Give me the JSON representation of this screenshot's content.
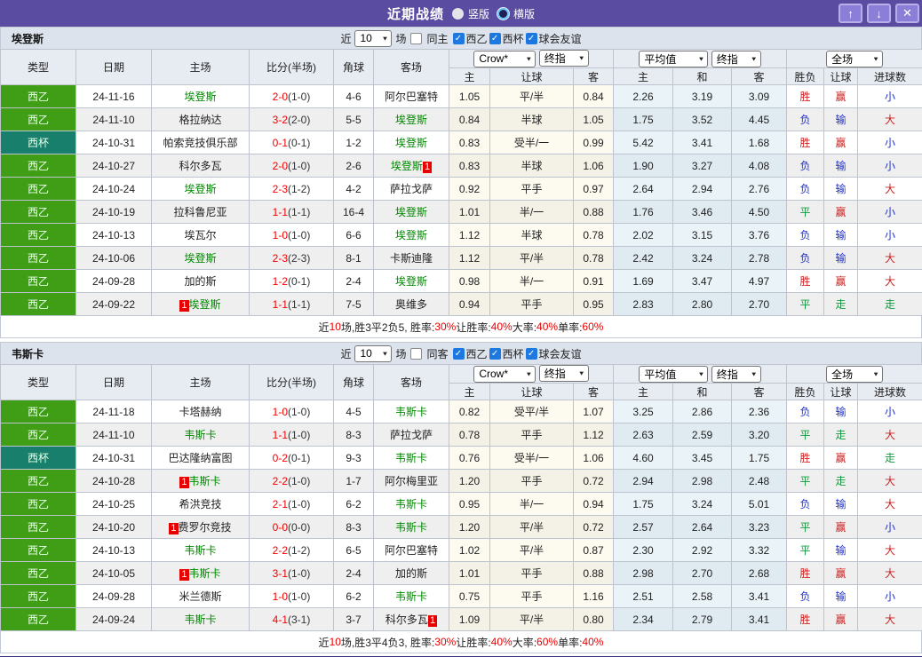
{
  "titlebar": {
    "title": "近期战绩",
    "vertical_label": "竖版",
    "horizontal_label": "横版",
    "vertical_checked": false,
    "horizontal_checked": true,
    "up_glyph": "↑",
    "down_glyph": "↓",
    "close_glyph": "✕"
  },
  "colors": {
    "titlebar_purple": "#5a4ca0",
    "bottom_bar_purple": "#3a3383",
    "league_green": "#3f9d16",
    "cup_teal": "#177f6b",
    "focus_team_green": "#008800",
    "score_red": "#f20000",
    "win_red": "#cc2222",
    "lose_blue": "#2233cc",
    "draw_green": "#159940",
    "badge_red": "#e80000"
  },
  "table_header": {
    "main_cols": [
      "类型",
      "日期",
      "主场",
      "比分(半场)",
      "角球",
      "客场"
    ],
    "sub_cols": [
      "主",
      "让球",
      "客",
      "主",
      "和",
      "客",
      "胜负",
      "让球",
      "进球数"
    ],
    "group1_select1": "Crow*",
    "group1_select2": "终指",
    "group2_select1": "平均值",
    "group2_select2": "终指",
    "group3_select": "全场"
  },
  "sections": [
    {
      "team": "埃登斯",
      "filter": {
        "near_label": "近",
        "count": "10",
        "games_label": "场",
        "same_label": "同主",
        "same_checked": false,
        "leagues": [
          {
            "label": "西乙",
            "checked": true
          },
          {
            "label": "西杯",
            "checked": true
          },
          {
            "label": "球会友谊",
            "checked": true
          }
        ]
      },
      "rows": [
        {
          "lg": "西乙",
          "lgc": "g",
          "date": "24-11-16",
          "home": {
            "pre": "",
            "name": "埃登斯",
            "post": "",
            "f": true
          },
          "score": "2-0",
          "half": "(1-0)",
          "cor": "4-6",
          "away": {
            "pre": "",
            "name": "阿尔巴塞特",
            "post": "",
            "f": false
          },
          "odds": [
            "1.05",
            "平/半",
            "0.84"
          ],
          "avg": [
            "2.26",
            "3.19",
            "3.09"
          ],
          "res": [
            [
              "胜",
              "r"
            ],
            [
              "赢",
              "r"
            ],
            [
              "小",
              "b"
            ]
          ]
        },
        {
          "lg": "西乙",
          "lgc": "g",
          "date": "24-11-10",
          "home": {
            "pre": "",
            "name": "格拉纳达",
            "post": "",
            "f": false
          },
          "score": "3-2",
          "half": "(2-0)",
          "cor": "5-5",
          "away": {
            "pre": "",
            "name": "埃登斯",
            "post": "",
            "f": true
          },
          "odds": [
            "0.84",
            "半球",
            "1.05"
          ],
          "avg": [
            "1.75",
            "3.52",
            "4.45"
          ],
          "res": [
            [
              "负",
              "b"
            ],
            [
              "输",
              "b"
            ],
            [
              "大",
              "r"
            ]
          ]
        },
        {
          "lg": "西杯",
          "lgc": "t",
          "date": "24-10-31",
          "home": {
            "pre": "",
            "name": "帕索竞技俱乐部",
            "post": "",
            "f": false
          },
          "score": "0-1",
          "half": "(0-1)",
          "cor": "1-2",
          "away": {
            "pre": "",
            "name": "埃登斯",
            "post": "",
            "f": true
          },
          "odds": [
            "0.83",
            "受半/一",
            "0.99"
          ],
          "avg": [
            "5.42",
            "3.41",
            "1.68"
          ],
          "res": [
            [
              "胜",
              "r"
            ],
            [
              "赢",
              "r"
            ],
            [
              "小",
              "b"
            ]
          ]
        },
        {
          "lg": "西乙",
          "lgc": "g",
          "date": "24-10-27",
          "home": {
            "pre": "",
            "name": "科尔多瓦",
            "post": "",
            "f": false
          },
          "score": "2-0",
          "half": "(1-0)",
          "cor": "2-6",
          "away": {
            "pre": "",
            "name": "埃登斯",
            "post": "1",
            "f": true
          },
          "odds": [
            "0.83",
            "半球",
            "1.06"
          ],
          "avg": [
            "1.90",
            "3.27",
            "4.08"
          ],
          "res": [
            [
              "负",
              "b"
            ],
            [
              "输",
              "b"
            ],
            [
              "小",
              "b"
            ]
          ]
        },
        {
          "lg": "西乙",
          "lgc": "g",
          "date": "24-10-24",
          "home": {
            "pre": "",
            "name": "埃登斯",
            "post": "",
            "f": true
          },
          "score": "2-3",
          "half": "(1-2)",
          "cor": "4-2",
          "away": {
            "pre": "",
            "name": "萨拉戈萨",
            "post": "",
            "f": false
          },
          "odds": [
            "0.92",
            "平手",
            "0.97"
          ],
          "avg": [
            "2.64",
            "2.94",
            "2.76"
          ],
          "res": [
            [
              "负",
              "b"
            ],
            [
              "输",
              "b"
            ],
            [
              "大",
              "r"
            ]
          ]
        },
        {
          "lg": "西乙",
          "lgc": "g",
          "date": "24-10-19",
          "home": {
            "pre": "",
            "name": "拉科鲁尼亚",
            "post": "",
            "f": false
          },
          "score": "1-1",
          "half": "(1-1)",
          "cor": "16-4",
          "away": {
            "pre": "",
            "name": "埃登斯",
            "post": "",
            "f": true
          },
          "odds": [
            "1.01",
            "半/一",
            "0.88"
          ],
          "avg": [
            "1.76",
            "3.46",
            "4.50"
          ],
          "res": [
            [
              "平",
              "g"
            ],
            [
              "赢",
              "r"
            ],
            [
              "小",
              "b"
            ]
          ]
        },
        {
          "lg": "西乙",
          "lgc": "g",
          "date": "24-10-13",
          "home": {
            "pre": "",
            "name": "埃瓦尔",
            "post": "",
            "f": false
          },
          "score": "1-0",
          "half": "(1-0)",
          "cor": "6-6",
          "away": {
            "pre": "",
            "name": "埃登斯",
            "post": "",
            "f": true
          },
          "odds": [
            "1.12",
            "半球",
            "0.78"
          ],
          "avg": [
            "2.02",
            "3.15",
            "3.76"
          ],
          "res": [
            [
              "负",
              "b"
            ],
            [
              "输",
              "b"
            ],
            [
              "小",
              "b"
            ]
          ]
        },
        {
          "lg": "西乙",
          "lgc": "g",
          "date": "24-10-06",
          "home": {
            "pre": "",
            "name": "埃登斯",
            "post": "",
            "f": true
          },
          "score": "2-3",
          "half": "(2-3)",
          "cor": "8-1",
          "away": {
            "pre": "",
            "name": "卡斯迪隆",
            "post": "",
            "f": false
          },
          "odds": [
            "1.12",
            "平/半",
            "0.78"
          ],
          "avg": [
            "2.42",
            "3.24",
            "2.78"
          ],
          "res": [
            [
              "负",
              "b"
            ],
            [
              "输",
              "b"
            ],
            [
              "大",
              "r"
            ]
          ]
        },
        {
          "lg": "西乙",
          "lgc": "g",
          "date": "24-09-28",
          "home": {
            "pre": "",
            "name": "加的斯",
            "post": "",
            "f": false
          },
          "score": "1-2",
          "half": "(0-1)",
          "cor": "2-4",
          "away": {
            "pre": "",
            "name": "埃登斯",
            "post": "",
            "f": true
          },
          "odds": [
            "0.98",
            "半/一",
            "0.91"
          ],
          "avg": [
            "1.69",
            "3.47",
            "4.97"
          ],
          "res": [
            [
              "胜",
              "r"
            ],
            [
              "赢",
              "r"
            ],
            [
              "大",
              "r"
            ]
          ]
        },
        {
          "lg": "西乙",
          "lgc": "g",
          "date": "24-09-22",
          "home": {
            "pre": "1",
            "name": "埃登斯",
            "post": "",
            "f": true
          },
          "score": "1-1",
          "half": "(1-1)",
          "cor": "7-5",
          "away": {
            "pre": "",
            "name": "奥维多",
            "post": "",
            "f": false
          },
          "odds": [
            "0.94",
            "平手",
            "0.95"
          ],
          "avg": [
            "2.83",
            "2.80",
            "2.70"
          ],
          "res": [
            [
              "平",
              "g"
            ],
            [
              "走",
              "g"
            ],
            [
              "走",
              "g"
            ]
          ]
        }
      ],
      "summary": [
        [
          "近",
          0
        ],
        [
          "10",
          1
        ],
        [
          "场,胜3平2负5, 胜率:",
          0
        ],
        [
          "30%",
          1
        ],
        [
          " 让胜率:",
          0
        ],
        [
          "40%",
          1
        ],
        [
          " 大率:",
          0
        ],
        [
          "40%",
          1
        ],
        [
          " 单率:",
          0
        ],
        [
          "60%",
          1
        ]
      ]
    },
    {
      "team": "韦斯卡",
      "filter": {
        "near_label": "近",
        "count": "10",
        "games_label": "场",
        "same_label": "同客",
        "same_checked": false,
        "leagues": [
          {
            "label": "西乙",
            "checked": true
          },
          {
            "label": "西杯",
            "checked": true
          },
          {
            "label": "球会友谊",
            "checked": true
          }
        ]
      },
      "rows": [
        {
          "lg": "西乙",
          "lgc": "g",
          "date": "24-11-18",
          "home": {
            "pre": "",
            "name": "卡塔赫纳",
            "post": "",
            "f": false
          },
          "score": "1-0",
          "half": "(1-0)",
          "cor": "4-5",
          "away": {
            "pre": "",
            "name": "韦斯卡",
            "post": "",
            "f": true
          },
          "odds": [
            "0.82",
            "受平/半",
            "1.07"
          ],
          "avg": [
            "3.25",
            "2.86",
            "2.36"
          ],
          "res": [
            [
              "负",
              "b"
            ],
            [
              "输",
              "b"
            ],
            [
              "小",
              "b"
            ]
          ]
        },
        {
          "lg": "西乙",
          "lgc": "g",
          "date": "24-11-10",
          "home": {
            "pre": "",
            "name": "韦斯卡",
            "post": "",
            "f": true
          },
          "score": "1-1",
          "half": "(1-0)",
          "cor": "8-3",
          "away": {
            "pre": "",
            "name": "萨拉戈萨",
            "post": "",
            "f": false
          },
          "odds": [
            "0.78",
            "平手",
            "1.12"
          ],
          "avg": [
            "2.63",
            "2.59",
            "3.20"
          ],
          "res": [
            [
              "平",
              "g"
            ],
            [
              "走",
              "g"
            ],
            [
              "大",
              "r"
            ]
          ]
        },
        {
          "lg": "西杯",
          "lgc": "t",
          "date": "24-10-31",
          "home": {
            "pre": "",
            "name": "巴达隆纳富图",
            "post": "",
            "f": false
          },
          "score": "0-2",
          "half": "(0-1)",
          "cor": "9-3",
          "away": {
            "pre": "",
            "name": "韦斯卡",
            "post": "",
            "f": true
          },
          "odds": [
            "0.76",
            "受半/一",
            "1.06"
          ],
          "avg": [
            "4.60",
            "3.45",
            "1.75"
          ],
          "res": [
            [
              "胜",
              "r"
            ],
            [
              "赢",
              "r"
            ],
            [
              "走",
              "g"
            ]
          ]
        },
        {
          "lg": "西乙",
          "lgc": "g",
          "date": "24-10-28",
          "home": {
            "pre": "1",
            "name": "韦斯卡",
            "post": "",
            "f": true
          },
          "score": "2-2",
          "half": "(1-0)",
          "cor": "1-7",
          "away": {
            "pre": "",
            "name": "阿尔梅里亚",
            "post": "",
            "f": false
          },
          "odds": [
            "1.20",
            "平手",
            "0.72"
          ],
          "avg": [
            "2.94",
            "2.98",
            "2.48"
          ],
          "res": [
            [
              "平",
              "g"
            ],
            [
              "走",
              "g"
            ],
            [
              "大",
              "r"
            ]
          ]
        },
        {
          "lg": "西乙",
          "lgc": "g",
          "date": "24-10-25",
          "home": {
            "pre": "",
            "name": "希洪竞技",
            "post": "",
            "f": false
          },
          "score": "2-1",
          "half": "(1-0)",
          "cor": "6-2",
          "away": {
            "pre": "",
            "name": "韦斯卡",
            "post": "",
            "f": true
          },
          "odds": [
            "0.95",
            "半/一",
            "0.94"
          ],
          "avg": [
            "1.75",
            "3.24",
            "5.01"
          ],
          "res": [
            [
              "负",
              "b"
            ],
            [
              "输",
              "b"
            ],
            [
              "大",
              "r"
            ]
          ]
        },
        {
          "lg": "西乙",
          "lgc": "g",
          "date": "24-10-20",
          "home": {
            "pre": "1",
            "name": "费罗尔竞技",
            "post": "",
            "f": false
          },
          "score": "0-0",
          "half": "(0-0)",
          "cor": "8-3",
          "away": {
            "pre": "",
            "name": "韦斯卡",
            "post": "",
            "f": true
          },
          "odds": [
            "1.20",
            "平/半",
            "0.72"
          ],
          "avg": [
            "2.57",
            "2.64",
            "3.23"
          ],
          "res": [
            [
              "平",
              "g"
            ],
            [
              "赢",
              "r"
            ],
            [
              "小",
              "b"
            ]
          ]
        },
        {
          "lg": "西乙",
          "lgc": "g",
          "date": "24-10-13",
          "home": {
            "pre": "",
            "name": "韦斯卡",
            "post": "",
            "f": true
          },
          "score": "2-2",
          "half": "(1-2)",
          "cor": "6-5",
          "away": {
            "pre": "",
            "name": "阿尔巴塞特",
            "post": "",
            "f": false
          },
          "odds": [
            "1.02",
            "平/半",
            "0.87"
          ],
          "avg": [
            "2.30",
            "2.92",
            "3.32"
          ],
          "res": [
            [
              "平",
              "g"
            ],
            [
              "输",
              "b"
            ],
            [
              "大",
              "r"
            ]
          ]
        },
        {
          "lg": "西乙",
          "lgc": "g",
          "date": "24-10-05",
          "home": {
            "pre": "1",
            "name": "韦斯卡",
            "post": "",
            "f": true
          },
          "score": "3-1",
          "half": "(1-0)",
          "cor": "2-4",
          "away": {
            "pre": "",
            "name": "加的斯",
            "post": "",
            "f": false
          },
          "odds": [
            "1.01",
            "平手",
            "0.88"
          ],
          "avg": [
            "2.98",
            "2.70",
            "2.68"
          ],
          "res": [
            [
              "胜",
              "r"
            ],
            [
              "赢",
              "r"
            ],
            [
              "大",
              "r"
            ]
          ]
        },
        {
          "lg": "西乙",
          "lgc": "g",
          "date": "24-09-28",
          "home": {
            "pre": "",
            "name": "米兰德斯",
            "post": "",
            "f": false
          },
          "score": "1-0",
          "half": "(1-0)",
          "cor": "6-2",
          "away": {
            "pre": "",
            "name": "韦斯卡",
            "post": "",
            "f": true
          },
          "odds": [
            "0.75",
            "平手",
            "1.16"
          ],
          "avg": [
            "2.51",
            "2.58",
            "3.41"
          ],
          "res": [
            [
              "负",
              "b"
            ],
            [
              "输",
              "b"
            ],
            [
              "小",
              "b"
            ]
          ]
        },
        {
          "lg": "西乙",
          "lgc": "g",
          "date": "24-09-24",
          "home": {
            "pre": "",
            "name": "韦斯卡",
            "post": "",
            "f": true
          },
          "score": "4-1",
          "half": "(3-1)",
          "cor": "3-7",
          "away": {
            "pre": "",
            "name": "科尔多瓦",
            "post": "1",
            "f": false
          },
          "odds": [
            "1.09",
            "平/半",
            "0.80"
          ],
          "avg": [
            "2.34",
            "2.79",
            "3.41"
          ],
          "res": [
            [
              "胜",
              "r"
            ],
            [
              "赢",
              "r"
            ],
            [
              "大",
              "r"
            ]
          ]
        }
      ],
      "summary": [
        [
          "近",
          0
        ],
        [
          "10",
          1
        ],
        [
          "场,胜3平4负3, 胜率:",
          0
        ],
        [
          "30%",
          1
        ],
        [
          " 让胜率:",
          0
        ],
        [
          "40%",
          1
        ],
        [
          " 大率:",
          0
        ],
        [
          "60%",
          1
        ],
        [
          " 单率:",
          0
        ],
        [
          "40%",
          1
        ]
      ]
    }
  ]
}
